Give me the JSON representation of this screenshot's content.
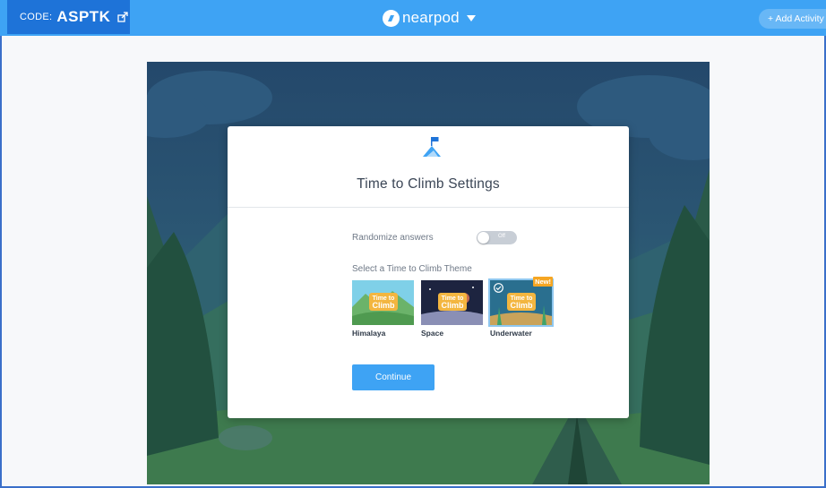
{
  "topbar": {
    "code_label": "CODE:",
    "code_value": "ASPTK",
    "brand_name": "nearpod",
    "add_activity": "+ Add Activity"
  },
  "modal": {
    "title": "Time to Climb Settings",
    "randomize_label": "Randomize answers",
    "toggle_text": "Off",
    "toggle_state": false,
    "theme_label": "Select a Time to Climb Theme",
    "themes": [
      {
        "name": "Himalaya",
        "selected": false,
        "badge": ""
      },
      {
        "name": "Space",
        "selected": false,
        "badge": ""
      },
      {
        "name": "Underwater",
        "selected": true,
        "badge": "New!"
      }
    ],
    "thumb_logo_top": "Time to",
    "thumb_logo_bottom": "Climb",
    "continue_label": "Continue"
  },
  "colors": {
    "topbar": "#3ea3f4",
    "code_box": "#1e73d8",
    "accent": "#3ea3f4",
    "badge": "#f6a623"
  }
}
